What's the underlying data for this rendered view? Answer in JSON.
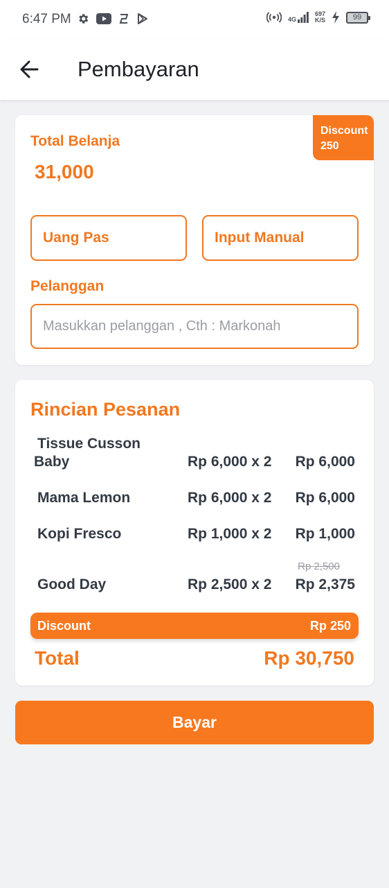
{
  "status_bar": {
    "time": "6:47 PM",
    "network": "4G",
    "speed_value": "697",
    "speed_unit": "K/S",
    "battery": "99"
  },
  "header": {
    "title": "Pembayaran"
  },
  "summary": {
    "total_label": "Total Belanja",
    "total_value": "31,000",
    "discount_badge_label": "Discount",
    "discount_badge_value": "250",
    "exact_money_label": "Uang Pas",
    "manual_input_label": "Input Manual",
    "customer_label": "Pelanggan",
    "customer_placeholder": "Masukkan pelanggan , Cth : Markonah",
    "customer_value": ""
  },
  "order": {
    "title": "Rincian Pesanan",
    "items": [
      {
        "name_line1": "Tissue Cusson",
        "name_line2": "Baby",
        "qty": "Rp 6,000 x 2",
        "subtotal": "Rp 6,000",
        "original": ""
      },
      {
        "name_line1": "Mama Lemon",
        "name_line2": "",
        "qty": "Rp 6,000 x 2",
        "subtotal": "Rp 6,000",
        "original": ""
      },
      {
        "name_line1": "Kopi Fresco",
        "name_line2": "",
        "qty": "Rp 1,000 x 2",
        "subtotal": "Rp 1,000",
        "original": ""
      },
      {
        "name_line1": "Good Day",
        "name_line2": "",
        "qty": "Rp 2,500 x 2",
        "subtotal": "Rp 2,375",
        "original": "Rp 2,500"
      }
    ],
    "discount_label": "Discount",
    "discount_value": "Rp 250",
    "total_label": "Total",
    "total_value": "Rp 30,750"
  },
  "actions": {
    "pay_label": "Bayar"
  },
  "colors": {
    "accent": "#f7781e",
    "text": "#333a44",
    "background": "#f1f2f4"
  }
}
